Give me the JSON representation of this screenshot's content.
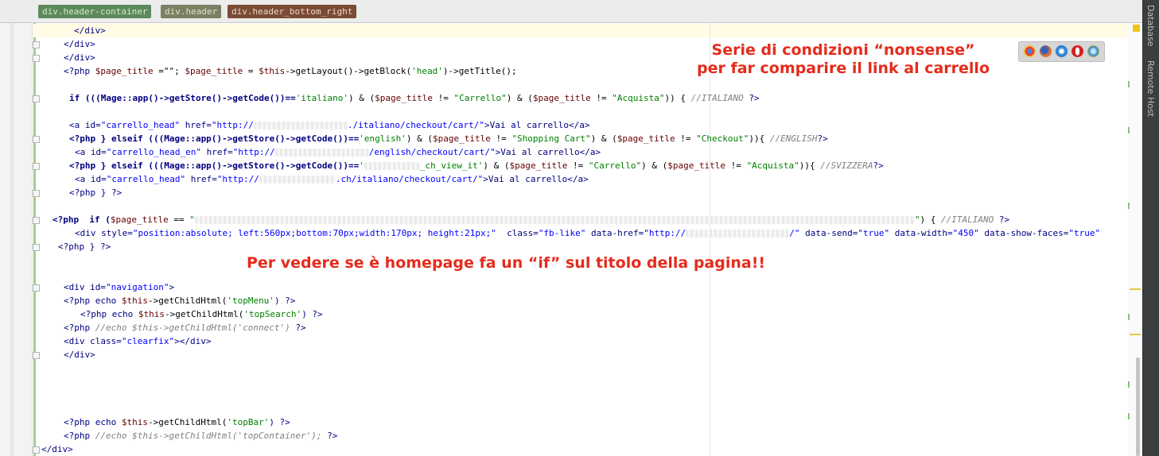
{
  "breadcrumbs": [
    "div.header-container",
    "div.header",
    "div.header_bottom_right"
  ],
  "side_tabs": [
    "Database",
    "Remote Host"
  ],
  "annotations": {
    "top_line1": "Serie di condizioni “nonsense”",
    "top_line2": "per far comparire il link al carrello",
    "middle": "Per vedere se è homepage fa un “if” sul titolo della pagina!!"
  },
  "browser_icons": [
    "chrome-icon",
    "firefox-icon",
    "safari-icon",
    "opera-icon",
    "ie-icon"
  ],
  "code": {
    "l1_close": "</div>",
    "l2": "</div>",
    "l3": "</div>",
    "l4_a": "<?php ",
    "l4_var1": "$page_title",
    "l4_b": " =\"\"; ",
    "l4_var2": "$page_title",
    "l4_c": " = ",
    "l4_this": "$this",
    "l4_d": "->getLayout()->getBlock(",
    "l4_str": "'head'",
    "l4_e": ")->getTitle();",
    "l5_a": "if (((Mage::app()->getStore()->getCode())==",
    "l5_str1": "'italiano'",
    "l5_b": ") & (",
    "l5_var1": "$page_title",
    "l5_c": " != ",
    "l5_str2": "\"Carrello\"",
    "l5_d": ") & (",
    "l5_var2": "$page_title",
    "l5_e": " != ",
    "l5_str3": "\"Acquista\"",
    "l5_f": ")) { ",
    "l5_comment": "//ITALIANO",
    "l5_g": " ?>",
    "l6_a": "<a id=",
    "l6_id": "\"carrello_head\"",
    "l6_b": " href=",
    "l6_href1": "\"http://",
    "l6_href2": "./italiano/checkout/cart/\"",
    "l6_c": ">Vai al carrello</a>",
    "l7_a": "<?php } elseif (((Mage::app()->getStore()->getCode())==",
    "l7_str1": "'english'",
    "l7_b": ") & (",
    "l7_var1": "$page_title",
    "l7_c": " != ",
    "l7_str2": "\"Shopping Cart\"",
    "l7_d": ") & (",
    "l7_var2": "$page_title",
    "l7_e": " != ",
    "l7_str3": "\"Checkout\"",
    "l7_f": ")){ ",
    "l7_comment": "//ENGLISH",
    "l7_g": "?>",
    "l8_a": "<a id=",
    "l8_id": "\"carrello_head_en\"",
    "l8_b": " href=",
    "l8_href1": "\"http://",
    "l8_href2": "/english/checkout/cart/\"",
    "l8_c": ">Vai al carrello</a>",
    "l9_a": "<?php } elseif (((Mage::app()->getStore()->getCode())==",
    "l9_str1": "'",
    "l9_str2": "_ch_view_it'",
    "l9_b": ") & (",
    "l9_var1": "$page_title",
    "l9_c": " != ",
    "l9_str3": "\"Carrello\"",
    "l9_d": ") & (",
    "l9_var2": "$page_title",
    "l9_e": " != ",
    "l9_str4": "\"Acquista\"",
    "l9_f": ")){ ",
    "l9_comment": "//SVIZZERA",
    "l9_g": "?>",
    "l10_a": "<a id=",
    "l10_id": "\"carrello_head\"",
    "l10_b": " href=",
    "l10_href1": "\"http://",
    "l10_href2": ".ch/italiano/checkout/cart/\"",
    "l10_c": ">Vai al carrello</a>",
    "l11": "<?php } ?>",
    "l12_a": "<?php  if (",
    "l12_var": "$page_title",
    "l12_b": " == ",
    "l12_str1": "\"",
    "l12_str2": "\"",
    "l12_c": ") { ",
    "l12_comment": "//ITALIANO",
    "l12_d": " ?>",
    "l13_a": "<div style=",
    "l13_style": "\"position:absolute; left:560px;bottom:70px;width:170px; height:21px;\"",
    "l13_b": "  class=",
    "l13_class": "\"fb-like\"",
    "l13_c": " data-href=",
    "l13_href1": "\"http://",
    "l13_href2": "/\"",
    "l13_d": " data-send=",
    "l13_send": "\"true\"",
    "l13_e": " data-width=",
    "l13_width": "\"450\"",
    "l13_f": " data-show-faces=",
    "l13_faces": "\"true\"",
    "l14": "<?php } ?>",
    "l15_a": "<div id=",
    "l15_id": "\"navigation\"",
    "l15_b": ">",
    "l16_a": "<?php echo ",
    "l16_this": "$this",
    "l16_b": "->getChildHtml(",
    "l16_str": "'topMenu'",
    "l16_c": ") ?>",
    "l17_a": "<?php echo ",
    "l17_this": "$this",
    "l17_b": "->getChildHtml(",
    "l17_str": "'topSearch'",
    "l17_c": ") ?>",
    "l18_a": "<?php ",
    "l18_comment": "//echo $this->getChildHtml('connect')",
    "l18_b": " ?>",
    "l19_a": "<div class=",
    "l19_class": "\"clearfix\"",
    "l19_b": "></div>",
    "l20": "</div>",
    "l21_a": "<?php echo ",
    "l21_this": "$this",
    "l21_b": "->getChildHtml(",
    "l21_str": "'topBar'",
    "l21_c": ") ?>",
    "l22_a": "<?php ",
    "l22_comment": "//echo $this->getChildHtml('topContainer');",
    "l22_b": " ?>",
    "l23": "</div>"
  }
}
